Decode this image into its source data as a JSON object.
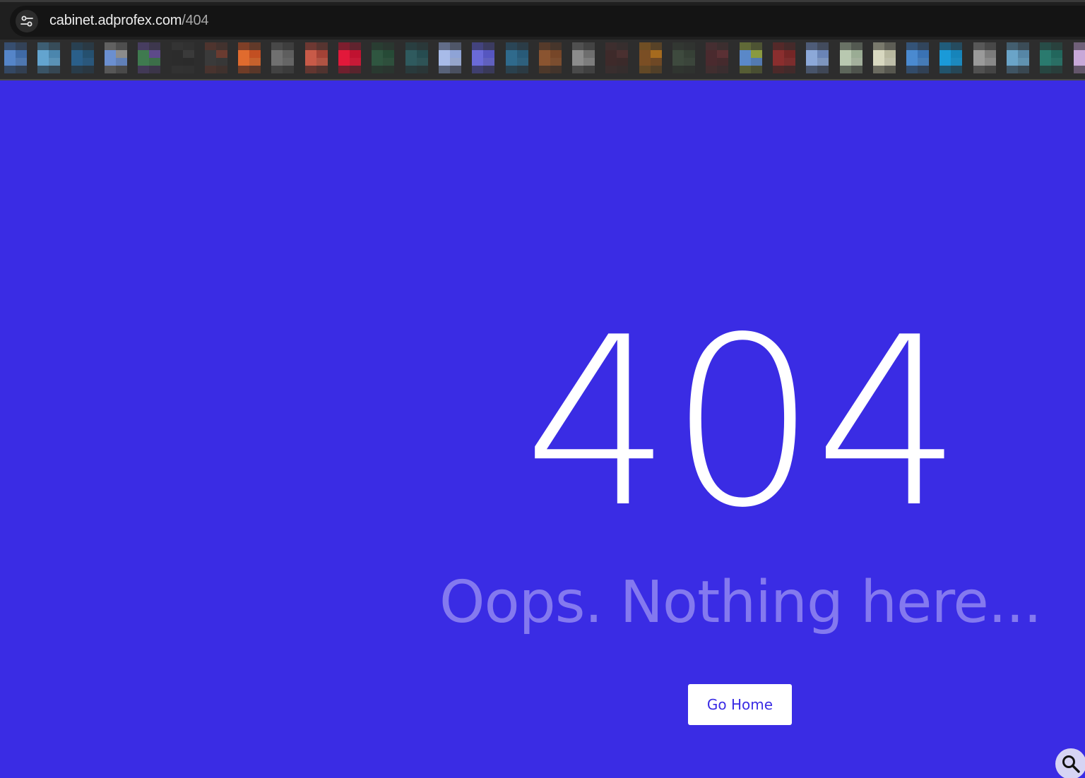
{
  "browser": {
    "url_host": "cabinet.adprofex.com",
    "url_path": "/404"
  },
  "bookmarks": {
    "colors": [
      [
        "#5585c8",
        "#3f6aa6"
      ],
      [
        "#63a4cf",
        "#4b86ad"
      ],
      [
        "#2a5f8a",
        "#25506f"
      ],
      [
        "#6b8fd0",
        "#8c8c8c"
      ],
      [
        "#3f7a4f",
        "#5d4a8a"
      ],
      [
        "#2c2c2c",
        "#3a3a3a"
      ],
      [
        "#3a3a3a",
        "#6a3b30"
      ],
      [
        "#e06b2e",
        "#c24f22"
      ],
      [
        "#707070",
        "#5e5e5e"
      ],
      [
        "#c85a48",
        "#a34236"
      ],
      [
        "#e2183a",
        "#c01230"
      ],
      [
        "#2f5640",
        "#264a36"
      ],
      [
        "#2f5a5e",
        "#264c50"
      ],
      [
        "#a8bbe8",
        "#8ea3d6"
      ],
      [
        "#6a6ad8",
        "#5656c0"
      ],
      [
        "#2f6a8c",
        "#285a78"
      ],
      [
        "#8a5430",
        "#764628"
      ],
      [
        "#8c8c8c",
        "#6e6e6e"
      ],
      [
        "#3e2a2a",
        "#4a3030"
      ],
      [
        "#7a4e24",
        "#a56a1e"
      ],
      [
        "#3e4a3e",
        "#364036"
      ],
      [
        "#4a2a2e",
        "#5a3034"
      ],
      [
        "#5a88c8",
        "#8a9a40"
      ],
      [
        "#8a2e2e",
        "#742626"
      ],
      [
        "#8ca8d8",
        "#6a84b6"
      ],
      [
        "#b8c8b0",
        "#9aac94"
      ],
      [
        "#d8d8c0",
        "#b8b8a0"
      ],
      [
        "#4a8ad0",
        "#3a72b4"
      ],
      [
        "#1a9ad8",
        "#1684ba"
      ],
      [
        "#9a9a9a",
        "#7c7c7c"
      ],
      [
        "#6aa4c8",
        "#5686a6"
      ],
      [
        "#2a7a6e",
        "#22665c"
      ],
      [
        "#c8a8d8",
        "#a88ab8"
      ]
    ]
  },
  "error": {
    "code": "404",
    "message": "Oops. Nothing here...",
    "button_label": "Go Home"
  },
  "icons": {
    "site_info": "tune-icon",
    "zoom": "magnifier-icon"
  },
  "theme": {
    "background": "#3a2ce4",
    "message_color": "#8479ef",
    "button_text": "#3a2ce4"
  }
}
